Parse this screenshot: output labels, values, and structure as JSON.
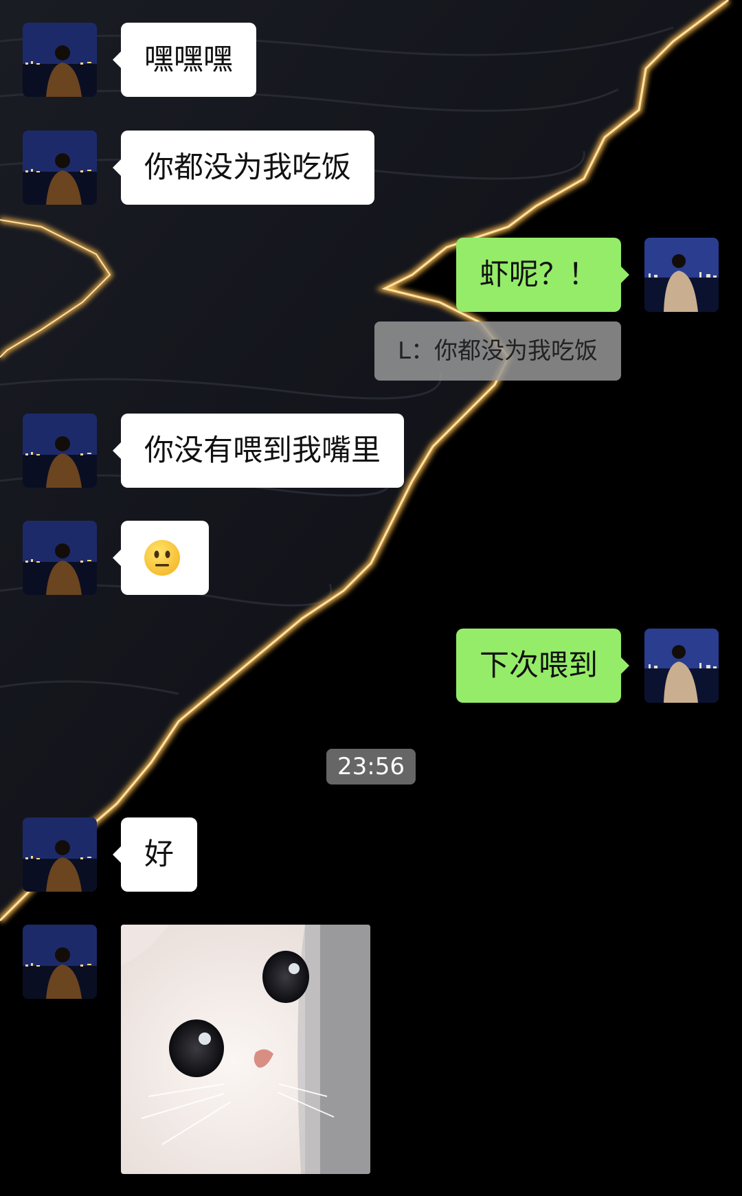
{
  "messages": [
    {
      "side": "in",
      "text": "嘿嘿嘿"
    },
    {
      "side": "in",
      "text": "你都没为我吃饭"
    },
    {
      "side": "out",
      "text": "虾呢？！",
      "quote": "L：你都没为我吃饭"
    },
    {
      "side": "in",
      "text": "你没有喂到我嘴里"
    },
    {
      "side": "in",
      "emoji": "neutral-face"
    },
    {
      "side": "out",
      "text": "下次喂到"
    },
    {
      "side": "in",
      "text": "好"
    },
    {
      "side": "in",
      "sticker": "white-kitten"
    }
  ],
  "timestamp": "23:56",
  "colors": {
    "incoming_bubble": "#ffffff",
    "outgoing_bubble": "#95ec69",
    "background": "#000000",
    "shore_glow": "#f5b54a"
  }
}
